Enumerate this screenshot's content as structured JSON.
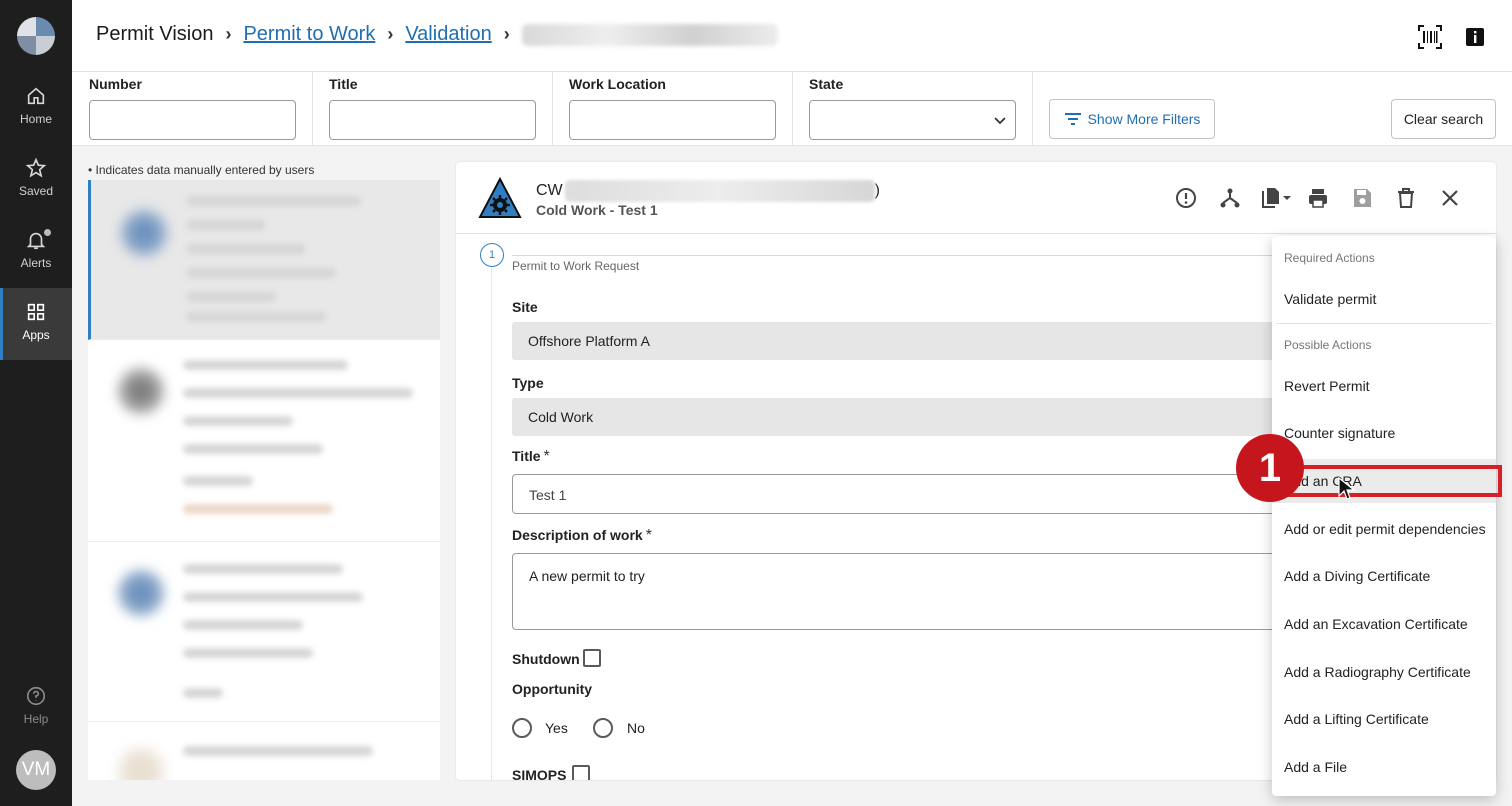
{
  "rail": {
    "items": [
      {
        "label": "Home",
        "icon": "home-icon"
      },
      {
        "label": "Saved",
        "icon": "star-icon"
      },
      {
        "label": "Alerts",
        "icon": "bell-icon"
      },
      {
        "label": "Apps",
        "icon": "apps-grid-icon"
      }
    ],
    "help_label": "Help",
    "avatar_initials": "VM"
  },
  "header": {
    "app_name": "Permit Vision",
    "crumb_1": "Permit to Work",
    "crumb_2": "Validation"
  },
  "filters": {
    "number_label": "Number",
    "title_label": "Title",
    "location_label": "Work Location",
    "state_label": "State",
    "more_filters_label": "Show More Filters",
    "clear_label": "Clear search"
  },
  "list": {
    "legend": "• Indicates data manually entered by users"
  },
  "permit": {
    "number_prefix": "CW",
    "number_suffix": ")",
    "subtitle": "Cold Work - Test 1",
    "step_number": "1",
    "step_label": "Permit to Work Request",
    "site_label": "Site",
    "site_value": "Offshore Platform A",
    "type_label": "Type",
    "type_value": "Cold Work",
    "title_label": "Title",
    "title_value": "Test 1",
    "desc_label": "Description of work",
    "desc_value": "A new permit to try",
    "required_mark": "*",
    "shutdown_label": "Shutdown",
    "opportunity_label": "Opportunity",
    "yes_label": "Yes",
    "no_label": "No",
    "simops_label": "SIMOPS"
  },
  "menu": {
    "required_header": "Required Actions",
    "required_items": [
      "Validate permit"
    ],
    "possible_header": "Possible Actions",
    "possible_items": [
      "Revert Permit",
      "Counter signature",
      "Add an CRA",
      "Add or edit permit dependencies",
      "Add a Diving Certificate",
      "Add an Excavation Certificate",
      "Add a Radiography Certificate",
      "Add a Lifting Certificate",
      "Add a File"
    ]
  },
  "annotation": {
    "badge_number": "1",
    "accent": "#d81f26"
  },
  "colors": {
    "link": "#1f6fb2",
    "rail_bg": "#1e1e1e",
    "selected_accent": "#2f7fc2"
  }
}
